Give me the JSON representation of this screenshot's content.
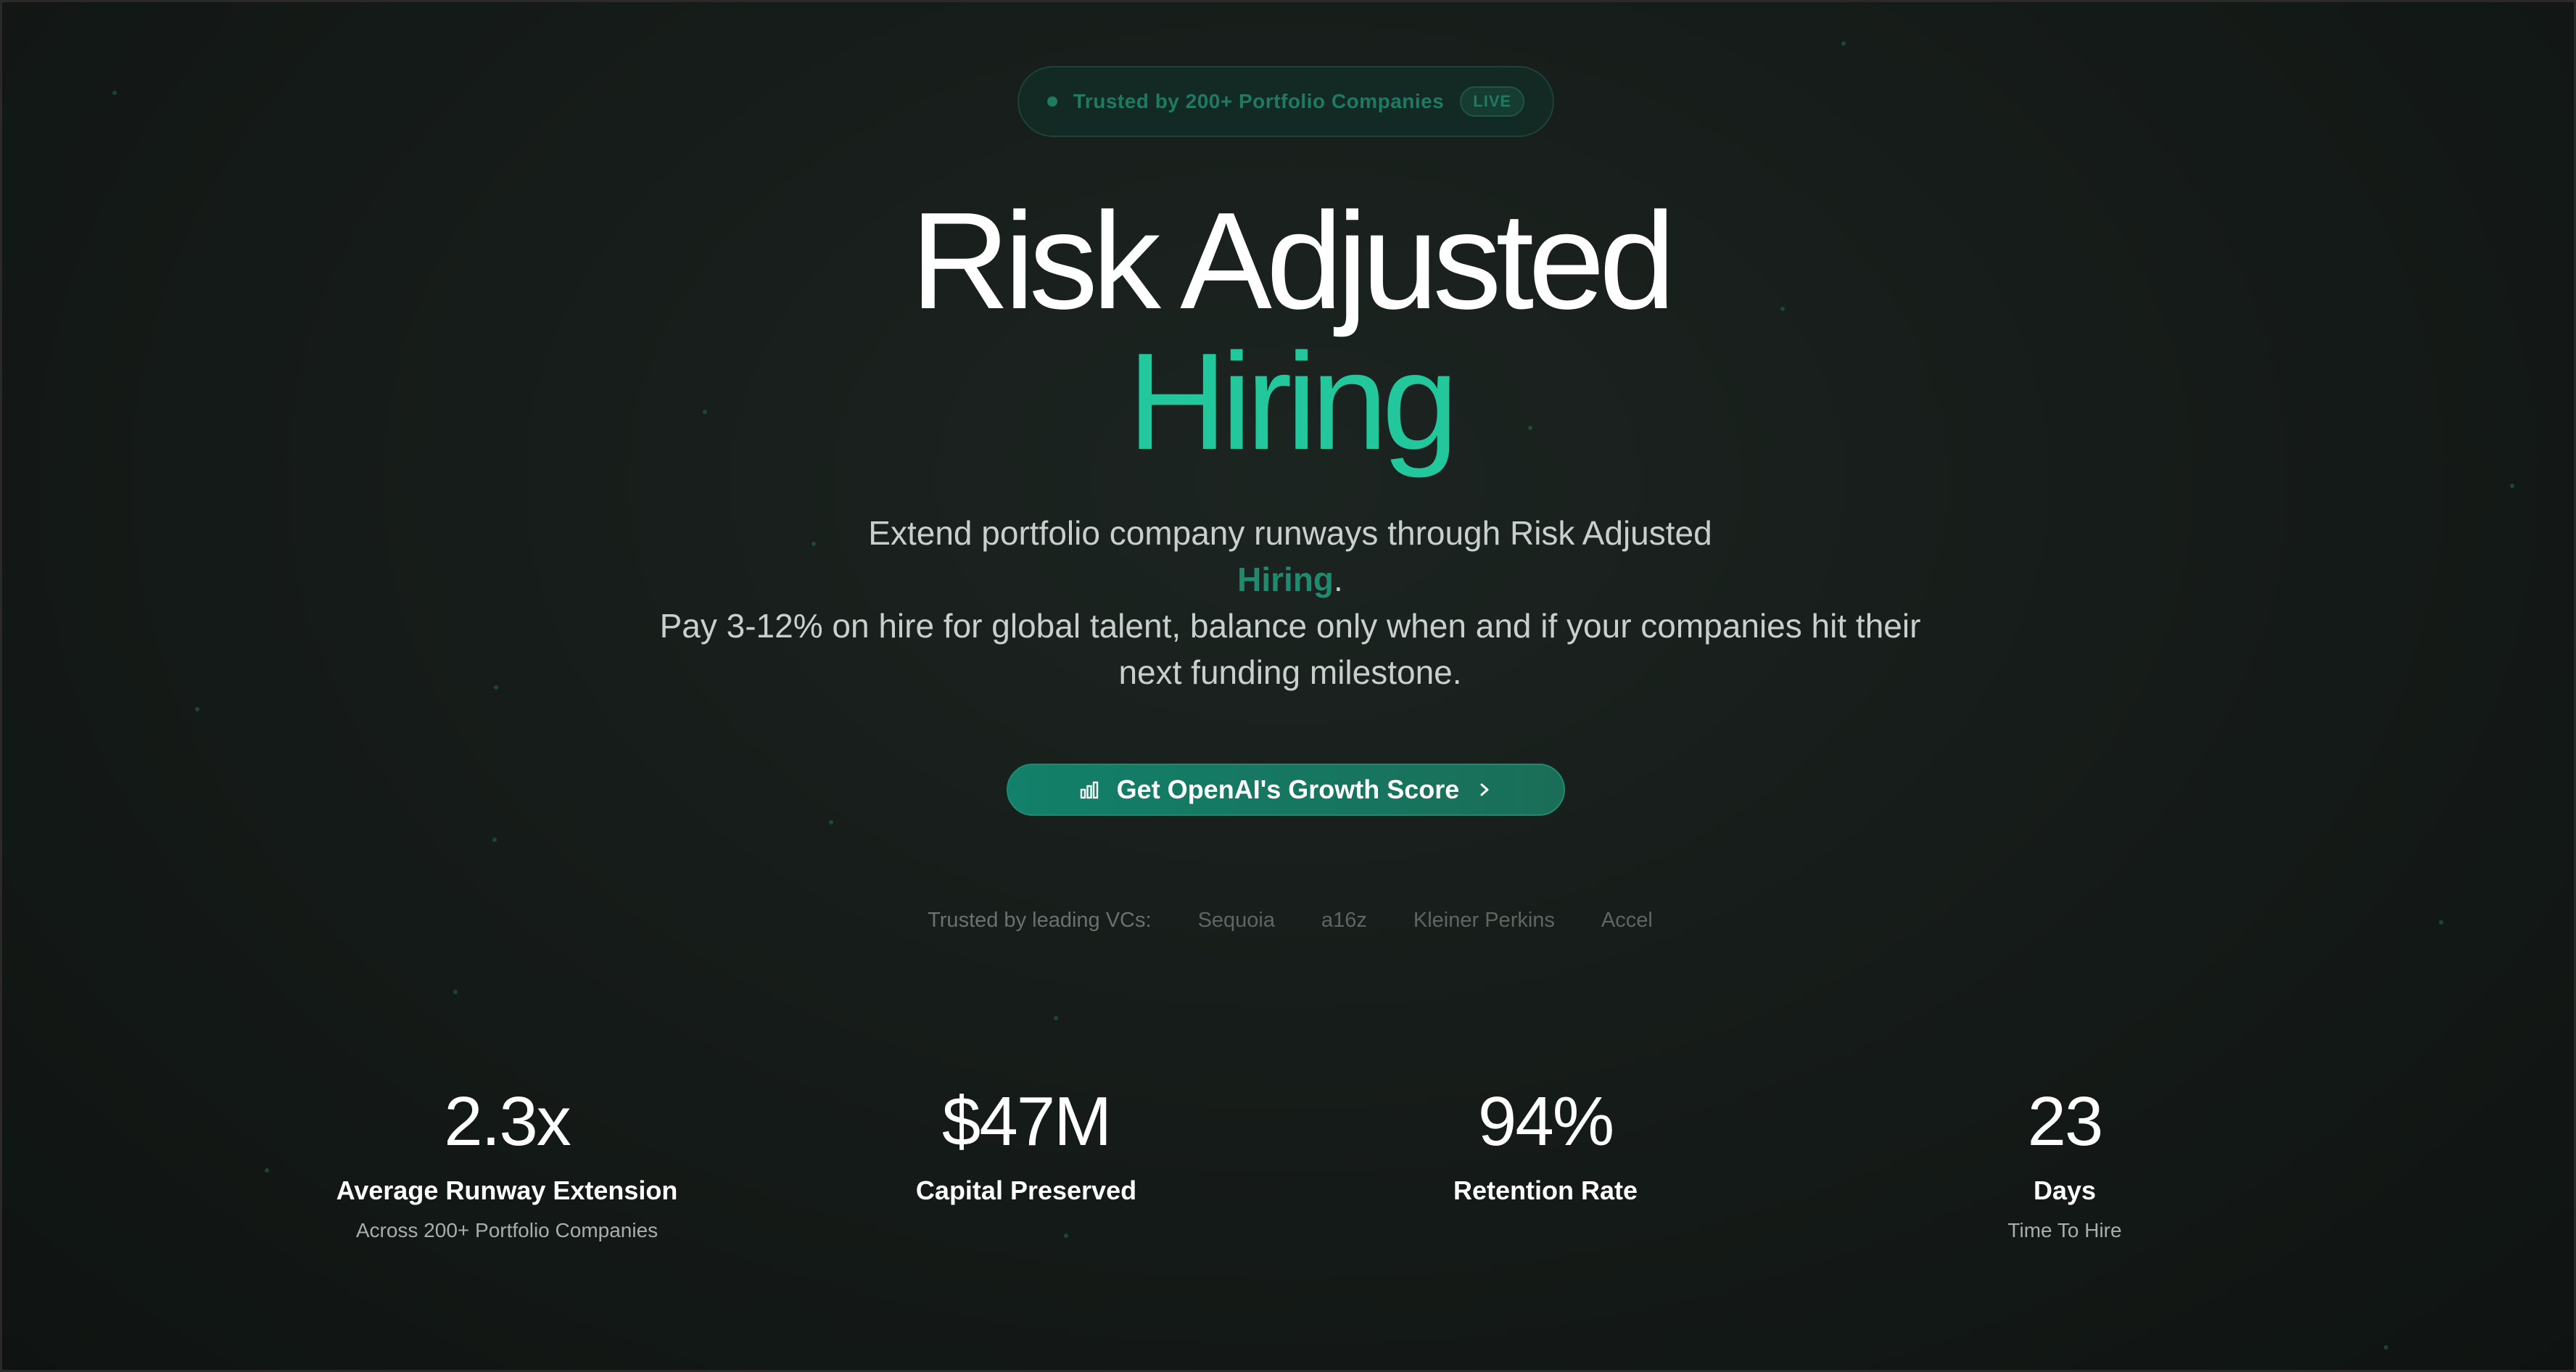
{
  "badge": {
    "text": "Trusted by 200+ Portfolio Companies",
    "live_label": "LIVE"
  },
  "hero": {
    "title_line1": "Risk Adjusted",
    "title_line2": "Hiring",
    "desc_line1": "Extend portfolio company runways through Risk Adjusted",
    "desc_highlight": "Hiring",
    "desc_period": ".",
    "desc_line3": "Pay 3-12% on hire for global talent, balance only when and if your companies hit their",
    "desc_line4": "next funding milestone."
  },
  "cta": {
    "label": "Get OpenAI's Growth Score",
    "icon": "bar-chart-icon",
    "chevron_icon": "chevron-right-icon"
  },
  "trusted_vcs": {
    "label": "Trusted by leading VCs:",
    "names": [
      "Sequoia",
      "a16z",
      "Kleiner Perkins",
      "Accel"
    ]
  },
  "stats": [
    {
      "value": "2.3x",
      "label": "Average Runway Extension",
      "sub": "Across 200+ Portfolio Companies"
    },
    {
      "value": "$47M",
      "label": "Capital Preserved",
      "sub": ""
    },
    {
      "value": "94%",
      "label": "Retention Rate",
      "sub": ""
    },
    {
      "value": "23",
      "label": "Days",
      "sub": "Time To Hire"
    }
  ],
  "colors": {
    "accent": "#22c79b",
    "accent_dark": "#1f8a6d",
    "background": "#161c19"
  }
}
